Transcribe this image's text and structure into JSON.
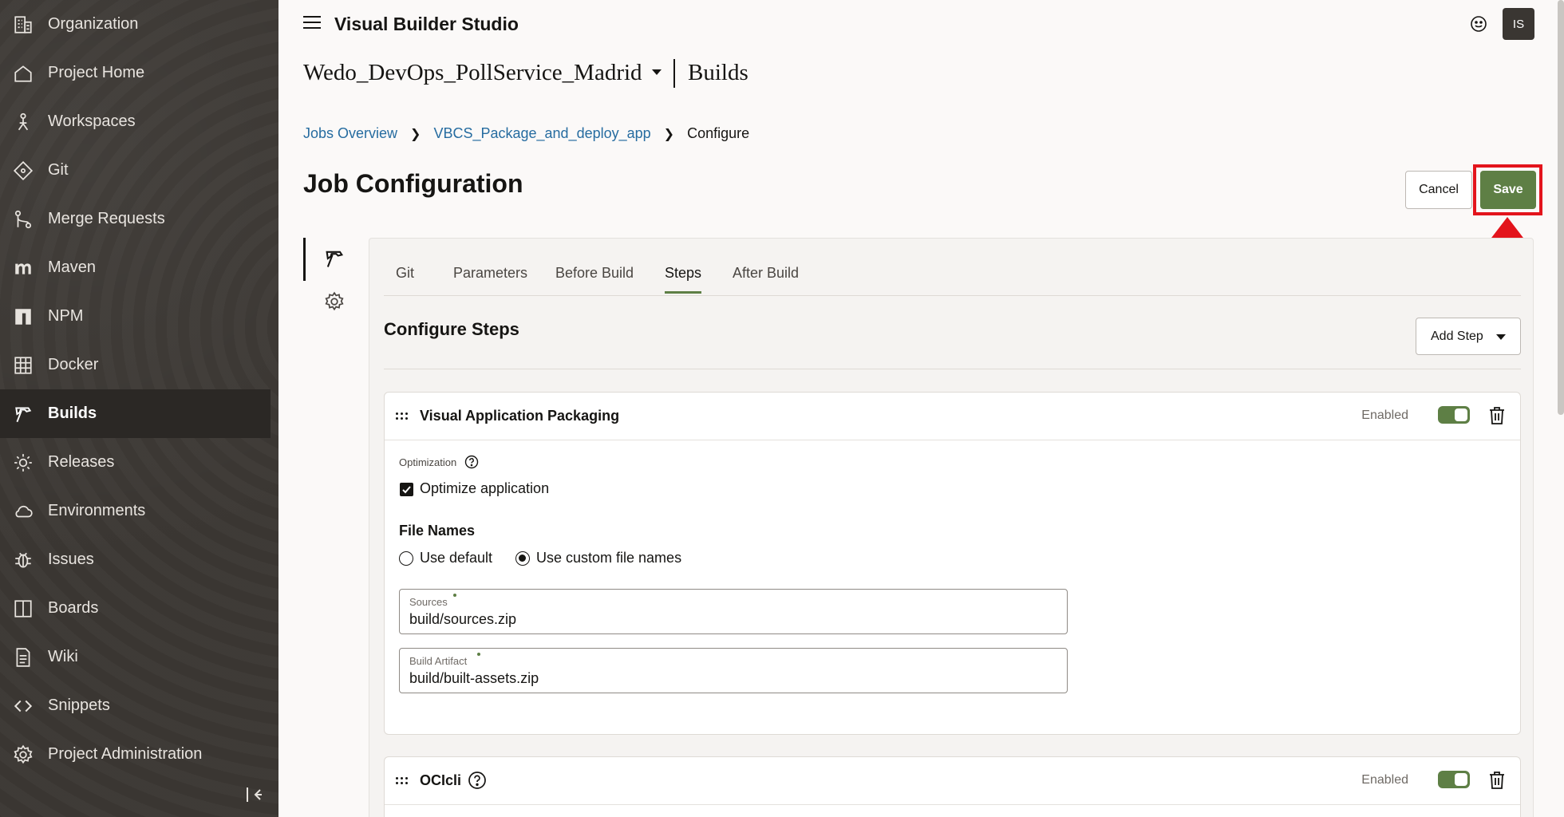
{
  "sidebar": {
    "items": [
      {
        "label": "Organization",
        "icon": "organization-icon"
      },
      {
        "label": "Project Home",
        "icon": "home-icon"
      },
      {
        "label": "Workspaces",
        "icon": "workspaces-icon"
      },
      {
        "label": "Git",
        "icon": "git-icon"
      },
      {
        "label": "Merge Requests",
        "icon": "merge-request-icon"
      },
      {
        "label": "Maven",
        "icon": "maven-icon"
      },
      {
        "label": "NPM",
        "icon": "npm-icon"
      },
      {
        "label": "Docker",
        "icon": "docker-icon"
      },
      {
        "label": "Builds",
        "icon": "builds-icon",
        "active": true
      },
      {
        "label": "Releases",
        "icon": "releases-icon"
      },
      {
        "label": "Environments",
        "icon": "environments-icon"
      },
      {
        "label": "Issues",
        "icon": "issues-icon"
      },
      {
        "label": "Boards",
        "icon": "boards-icon"
      },
      {
        "label": "Wiki",
        "icon": "wiki-icon"
      },
      {
        "label": "Snippets",
        "icon": "snippets-icon"
      },
      {
        "label": "Project Administration",
        "icon": "admin-gear-icon"
      }
    ]
  },
  "header": {
    "app_title": "Visual Builder Studio",
    "avatar_initials": "IS",
    "project_name": "Wedo_DevOps_PollService_Madrid",
    "section_name": "Builds"
  },
  "breadcrumb": {
    "items": [
      "Jobs Overview",
      "VBCS_Package_and_deploy_app"
    ],
    "current": "Configure"
  },
  "page": {
    "title": "Job Configuration",
    "cancel_label": "Cancel",
    "save_label": "Save"
  },
  "tabs": [
    "Git",
    "Parameters",
    "Before Build",
    "Steps",
    "After Build"
  ],
  "active_tab": "Steps",
  "steps_section": {
    "title": "Configure Steps",
    "add_step_label": "Add Step"
  },
  "steps": [
    {
      "title": "Visual Application Packaging",
      "enabled_label": "Enabled",
      "enabled": true,
      "optimization_label": "Optimization",
      "optimize_label": "Optimize application",
      "optimize_checked": true,
      "file_names_title": "File Names",
      "radio_default": "Use default",
      "radio_custom": "Use custom file names",
      "selected": "Use custom file names",
      "sources_label": "Sources",
      "sources_value": "build/sources.zip",
      "artifact_label": "Build Artifact",
      "artifact_value": "build/built-assets.zip"
    },
    {
      "title": "OCIcli",
      "enabled_label": "Enabled",
      "enabled": true
    }
  ],
  "colors": {
    "sidebar_bg": "#3a3632",
    "accent_green": "#5e7f45",
    "link_blue": "#266ca0",
    "highlight_red": "#e3141c"
  }
}
